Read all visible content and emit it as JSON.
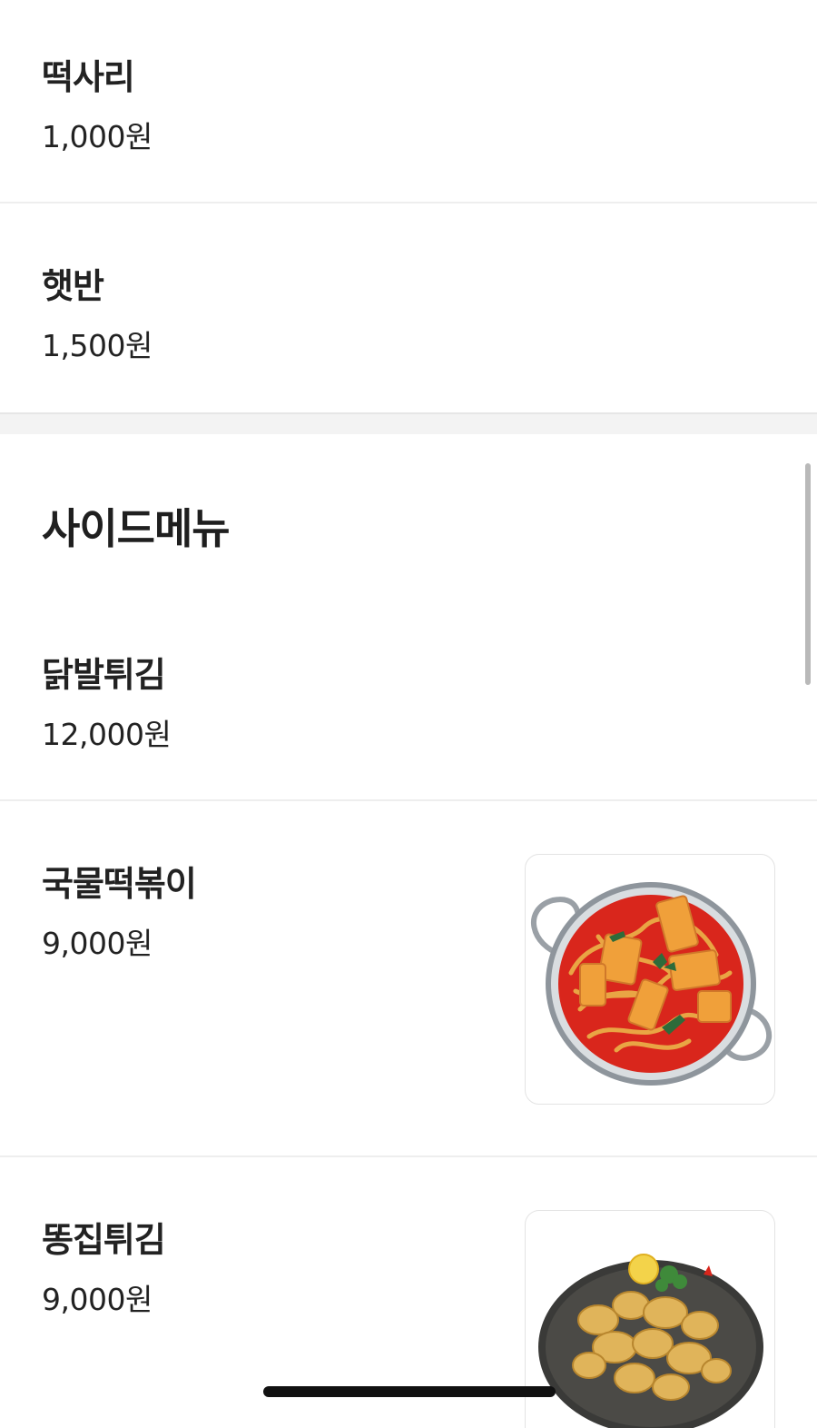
{
  "menu": {
    "top_items": [
      {
        "name": "떡사리",
        "price": "1,000원"
      },
      {
        "name": "햇반",
        "price": "1,500원"
      }
    ],
    "side_section": {
      "title": "사이드메뉴",
      "items": [
        {
          "name": "닭발튀김",
          "price": "12,000원"
        },
        {
          "name": "국물떡볶이",
          "price": "9,000원",
          "image": "tteokbokki-photo"
        },
        {
          "name": "똥집튀김",
          "price": "9,000원",
          "image": "fried-gizzard-photo"
        }
      ]
    }
  },
  "icons": {
    "home_indicator": "home-indicator-bar",
    "scrollbar": "vertical-scrollbar"
  },
  "colors": {
    "text": "#222222",
    "divider": "#eeeeee",
    "section_gap": "#f3f3f3",
    "sauce_red": "#d9261c",
    "fried_gold": "#e0b45a"
  }
}
